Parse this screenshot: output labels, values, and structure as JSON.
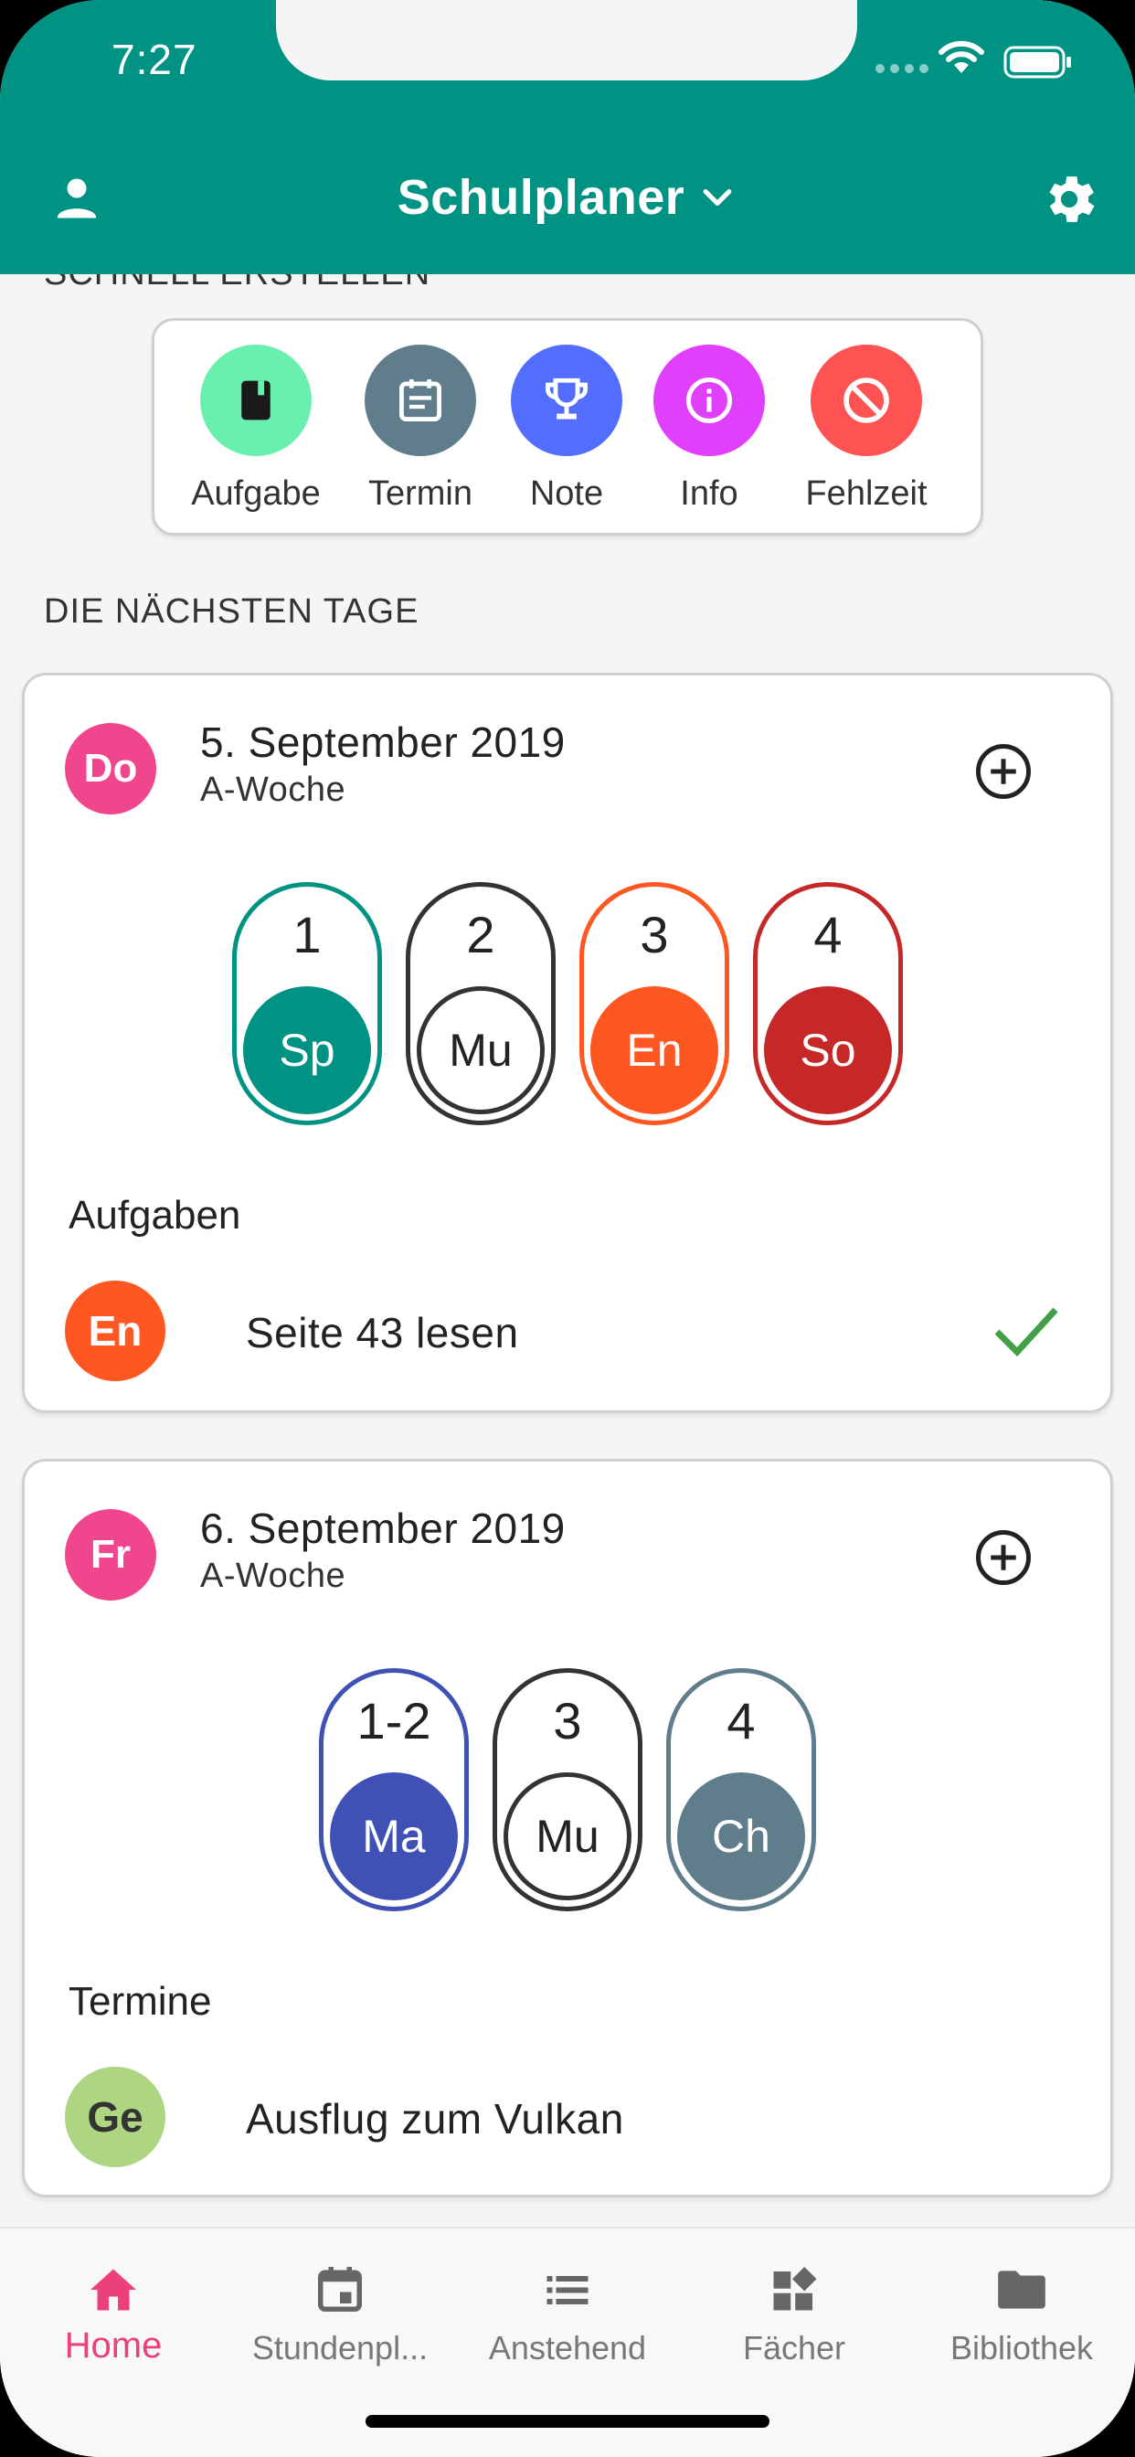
{
  "status_bar": {
    "time": "7:27"
  },
  "header": {
    "title": "Schulplaner"
  },
  "quick_create": {
    "section_label": "SCHNELL ERSTELLEN",
    "items": [
      {
        "label": "Aufgabe",
        "icon": "book-icon",
        "color": "#69f0ae"
      },
      {
        "label": "Termin",
        "icon": "calendar-event-icon",
        "color": "#607d8b"
      },
      {
        "label": "Note",
        "icon": "trophy-icon",
        "color": "#536dfe"
      },
      {
        "label": "Info",
        "icon": "info-icon",
        "color": "#e040fb"
      },
      {
        "label": "Fehlzeit",
        "icon": "block-icon",
        "color": "#ff5252"
      }
    ]
  },
  "upcoming": {
    "section_label": "DIE NÄCHSTEN TAGE",
    "days": [
      {
        "badge": "Do",
        "date": "5. September 2019",
        "week": "A-Woche",
        "lessons": [
          {
            "period": "1",
            "subject": "Sp",
            "color": "#009383",
            "style": "filled"
          },
          {
            "period": "2",
            "subject": "Mu",
            "color": "#333333",
            "style": "outline"
          },
          {
            "period": "3",
            "subject": "En",
            "color": "#ff5722",
            "style": "filled"
          },
          {
            "period": "4",
            "subject": "So",
            "color": "#c62828",
            "style": "filled"
          }
        ],
        "list_heading": "Aufgaben",
        "items": [
          {
            "subject": "En",
            "text": "Seite 43 lesen",
            "color": "#ff5722",
            "text_color": "#ffffff",
            "done": true
          }
        ]
      },
      {
        "badge": "Fr",
        "date": "6. September 2019",
        "week": "A-Woche",
        "lessons": [
          {
            "period": "1-2",
            "subject": "Ma",
            "color": "#3f51b5",
            "style": "filled"
          },
          {
            "period": "3",
            "subject": "Mu",
            "color": "#333333",
            "style": "outline"
          },
          {
            "period": "4",
            "subject": "Ch",
            "color": "#607d8b",
            "style": "filled"
          }
        ],
        "list_heading": "Termine",
        "items": [
          {
            "subject": "Ge",
            "text": "Ausflug zum Vulkan",
            "color": "#aed581",
            "text_color": "#333333",
            "done": false
          }
        ]
      }
    ]
  },
  "bottom_nav": {
    "items": [
      {
        "label": "Home",
        "icon": "home-icon",
        "active": true
      },
      {
        "label": "Stundenpl...",
        "icon": "calendar-icon",
        "active": false
      },
      {
        "label": "Anstehend",
        "icon": "list-icon",
        "active": false
      },
      {
        "label": "Fächer",
        "icon": "widgets-icon",
        "active": false
      },
      {
        "label": "Bibliothek",
        "icon": "folder-icon",
        "active": false
      }
    ]
  },
  "colors": {
    "primary": "#009383",
    "accent": "#ec407a",
    "check": "#43a047"
  }
}
